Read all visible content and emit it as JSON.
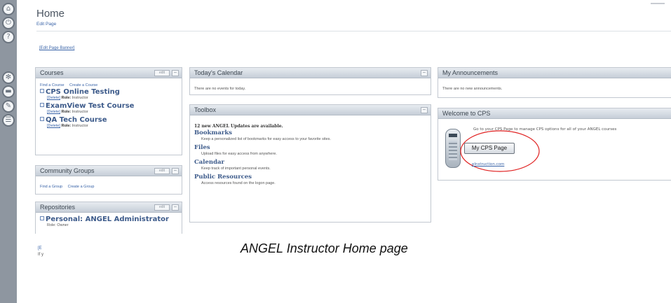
{
  "page": {
    "title": "Home",
    "edit_page": "Edit Page",
    "edit_banner": "[Edit Page Banner]"
  },
  "rail": {
    "icons": [
      "home-icon",
      "power-icon",
      "help-icon",
      "settings-icon",
      "folder-icon",
      "tools-icon",
      "chat-icon"
    ]
  },
  "courses": {
    "header": "Courses",
    "edit": "edit",
    "find": "Find a Course",
    "create": "Create a Course",
    "items": [
      {
        "title": "CPS Online Testing",
        "delete": "[Delete]",
        "role_label": "Role:",
        "role": "Instructor"
      },
      {
        "title": "ExamView Test Course",
        "delete": "[Delete]",
        "role_label": "Role:",
        "role": "Instructor"
      },
      {
        "title": "QA Tech Course",
        "delete": "[Delete]",
        "role_label": "Role:",
        "role": "Instructor"
      }
    ]
  },
  "community": {
    "header": "Community Groups",
    "edit": "edit",
    "find": "Find a Group",
    "create": "Create a Group"
  },
  "repositories": {
    "header": "Repositories",
    "edit": "edit",
    "item_title": "Personal: ANGEL Administrator",
    "role_partial": "Role: Owner"
  },
  "stubs": {
    "link": "[E",
    "text": "If y"
  },
  "calendar": {
    "header": "Today's Calendar",
    "empty": "There are no events for today."
  },
  "toolbox": {
    "header": "Toolbox",
    "updates": "12 new ANGEL Updates are available.",
    "items": [
      {
        "title": "Bookmarks",
        "desc": "Keep a personalized list of bookmarks for easy access to your favorite sites."
      },
      {
        "title": "Files",
        "desc": "Upload files for easy access from anywhere."
      },
      {
        "title": "Calendar",
        "desc": "Keep track of important personal events."
      },
      {
        "title": "Public Resources",
        "desc": "Access resources found on the logon page."
      }
    ]
  },
  "announcements": {
    "header": "My Announcements",
    "empty": "There are no new announcements."
  },
  "welcome": {
    "header": "Welcome to CPS",
    "text": "Go to your CPS Page to manage CPS options for all of your ANGEL courses",
    "button": "My CPS Page",
    "link": "eInstruction.com",
    "highlight_color": "#e02020"
  },
  "caption": "ANGEL Instructor Home page"
}
